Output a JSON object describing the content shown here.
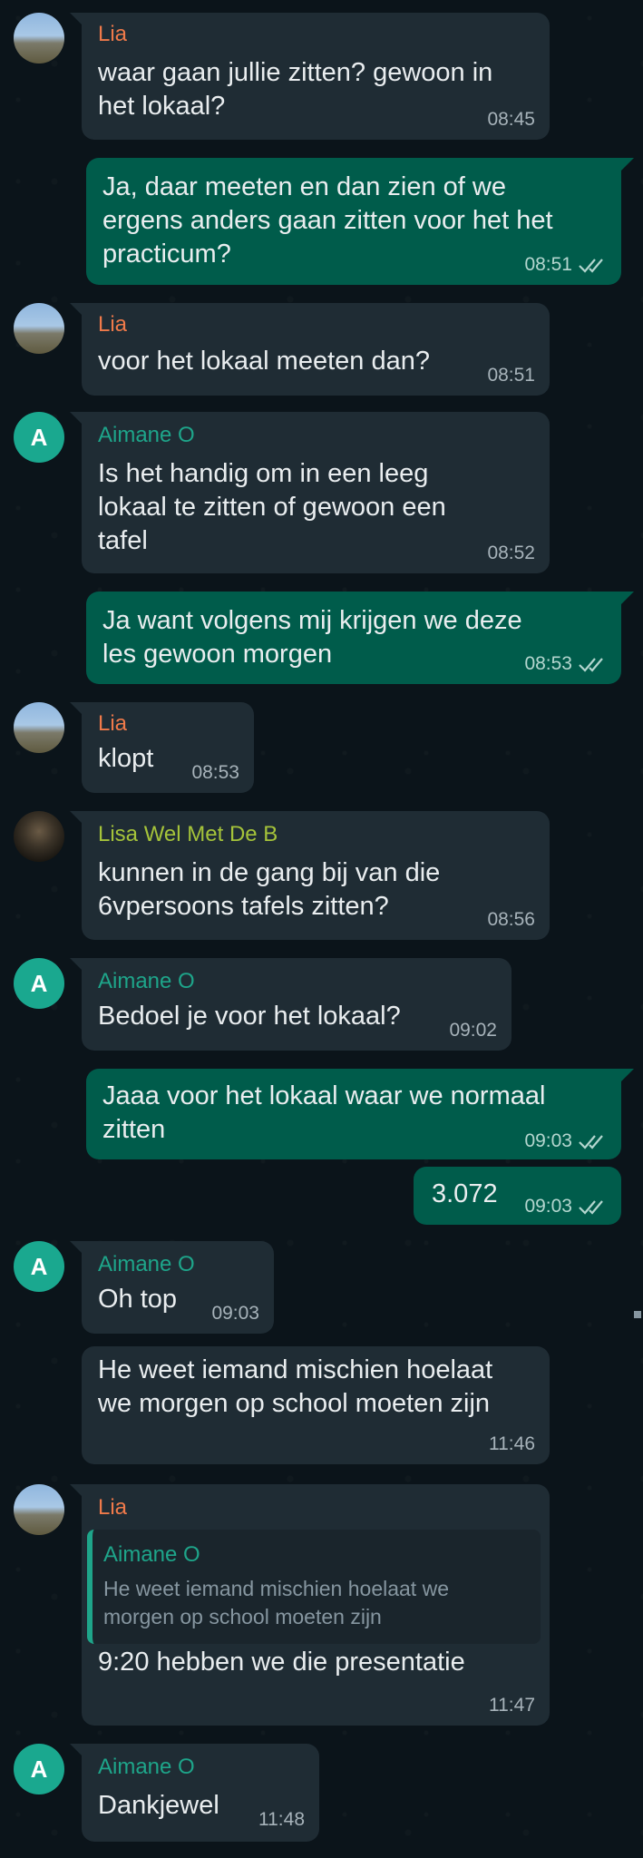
{
  "colors": {
    "background": "#0b141a",
    "incoming_bubble": "#1f2c34",
    "outgoing_bubble": "#005c4b",
    "lia_name": "#f07a4a",
    "aimane_name": "#1ea58a",
    "lisa_name": "#a5c33a",
    "read_ticks": "#b4d6cf"
  },
  "messages": [
    {
      "sender": "Lia",
      "text": "waar gaan jullie zitten? gewoon in\nhet lokaal?",
      "time": "08:45"
    },
    {
      "text": "Ja, daar meeten en dan zien of we\nergens anders gaan zitten voor het het\npracticum?",
      "time": "08:51",
      "status_icon": "double-check-icon"
    },
    {
      "sender": "Lia",
      "text": "voor het lokaal meeten dan?",
      "time": "08:51"
    },
    {
      "sender": "Aimane O",
      "avatar_letter": "A",
      "text": "Is het handig om in een leeg\nlokaal te zitten of gewoon een\ntafel",
      "time": "08:52"
    },
    {
      "text": "Ja want volgens mij krijgen we deze\nles gewoon morgen",
      "time": "08:53",
      "status_icon": "double-check-icon"
    },
    {
      "sender": "Lia",
      "text": "klopt",
      "time": "08:53"
    },
    {
      "sender": "Lisa Wel Met De B",
      "text": "kunnen in de gang bij van die\n6vpersoons tafels zitten?",
      "time": "08:56"
    },
    {
      "sender": "Aimane O",
      "avatar_letter": "A",
      "text": "Bedoel je voor het lokaal?",
      "time": "09:02"
    },
    {
      "text": "Jaaa voor het lokaal waar we normaal\nzitten",
      "time": "09:03",
      "status_icon": "double-check-icon"
    },
    {
      "text": "3.072",
      "time": "09:03",
      "status_icon": "double-check-icon"
    },
    {
      "sender": "Aimane O",
      "avatar_letter": "A",
      "text": "Oh top",
      "time": "09:03"
    },
    {
      "text": "He weet iemand mischien hoelaat\nwe morgen op school moeten zijn",
      "time": "11:46"
    },
    {
      "sender": "Lia",
      "quote_author": "Aimane O",
      "quote_text": "He weet iemand mischien hoelaat we\nmorgen op school moeten zijn",
      "text": "9:20 hebben we die presentatie",
      "time": "11:47"
    },
    {
      "sender": "Aimane O",
      "avatar_letter": "A",
      "text": "Dankjewel",
      "time": "11:48"
    }
  ]
}
